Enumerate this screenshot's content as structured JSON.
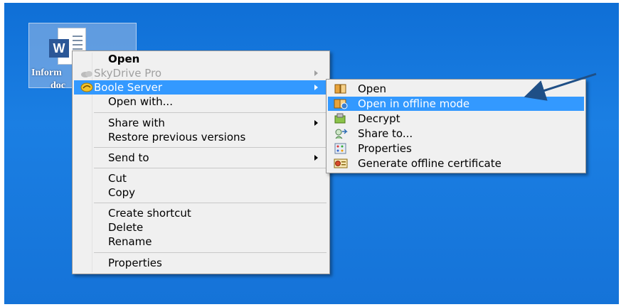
{
  "desktop_icon": {
    "word_letter": "W",
    "label_line1": "Inform",
    "label_line2": "doc"
  },
  "context_menu": {
    "items": [
      {
        "label": "Open"
      },
      {
        "label": "SkyDrive Pro"
      },
      {
        "label": "Boole Server"
      },
      {
        "label": "Open with..."
      },
      {
        "label": "Share with"
      },
      {
        "label": "Restore previous versions"
      },
      {
        "label": "Send to"
      },
      {
        "label": "Cut"
      },
      {
        "label": "Copy"
      },
      {
        "label": "Create shortcut"
      },
      {
        "label": "Delete"
      },
      {
        "label": "Rename"
      },
      {
        "label": "Properties"
      }
    ]
  },
  "submenu": {
    "items": [
      {
        "label": "Open",
        "icon": "book-icon"
      },
      {
        "label": "Open in offline mode",
        "icon": "offline-open-icon"
      },
      {
        "label": "Decrypt",
        "icon": "decrypt-icon"
      },
      {
        "label": "Share to...",
        "icon": "share-icon"
      },
      {
        "label": "Properties",
        "icon": "properties-icon"
      },
      {
        "label": "Generate offline certificate",
        "icon": "certificate-icon"
      }
    ]
  },
  "colors": {
    "desktop": "#1573d8",
    "highlight": "#3399ff",
    "menu_bg": "#f0f0f0"
  }
}
